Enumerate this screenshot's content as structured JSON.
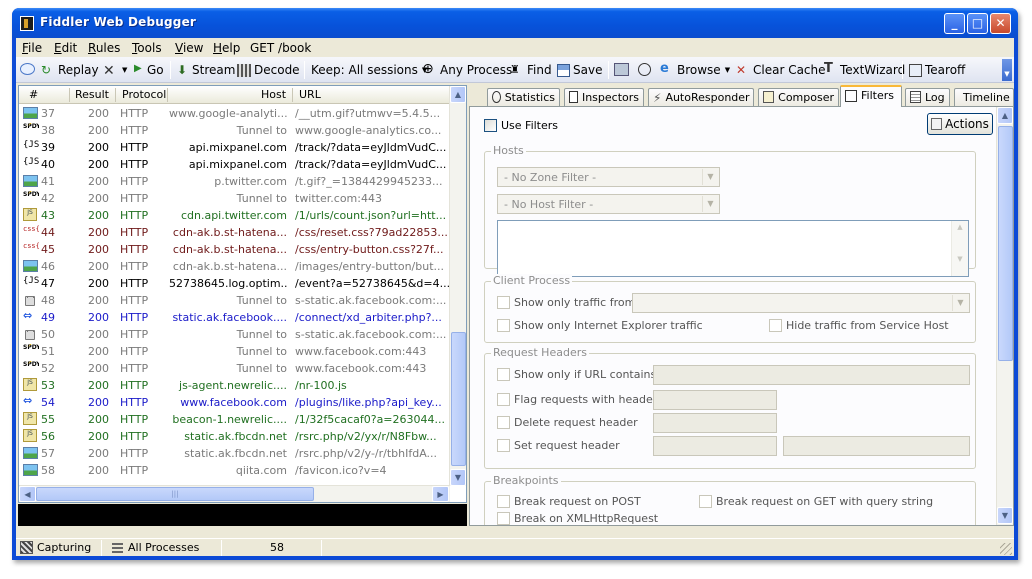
{
  "window": {
    "title": "Fiddler Web Debugger"
  },
  "menu": [
    {
      "label": "File",
      "u": "F",
      "rest": "ile"
    },
    {
      "label": "Edit",
      "u": "E",
      "rest": "dit"
    },
    {
      "label": "Rules",
      "u": "R",
      "rest": "ules"
    },
    {
      "label": "Tools",
      "u": "T",
      "rest": "ools"
    },
    {
      "label": "View",
      "u": "V",
      "rest": "iew"
    },
    {
      "label": "Help",
      "u": "H",
      "rest": "elp"
    },
    {
      "label": "GET /book",
      "u": "",
      "rest": "GET /book"
    }
  ],
  "toolbar": {
    "replay": "Replay",
    "go": "Go",
    "stream": "Stream",
    "decode": "Decode",
    "keep": "Keep: All sessions",
    "any_process": "Any Process",
    "find": "Find",
    "save": "Save",
    "browse": "Browse",
    "clear_cache": "Clear Cache",
    "textwizard": "TextWizard",
    "tearoff": "Tearoff"
  },
  "grid": {
    "headers": {
      "num": "#",
      "result": "Result",
      "protocol": "Protocol",
      "host": "Host",
      "url": "URL"
    },
    "rows": [
      {
        "icon": "img",
        "num": "37",
        "result": "200",
        "protocol": "HTTP",
        "host": "www.google-analyti...",
        "url": "/__utm.gif?utmwv=5.4.5...",
        "color": "gray"
      },
      {
        "icon": "spdy",
        "num": "38",
        "result": "200",
        "protocol": "HTTP",
        "host": "Tunnel to",
        "url": "www.google-analytics.co...",
        "color": "gray"
      },
      {
        "icon": "json",
        "num": "39",
        "result": "200",
        "protocol": "HTTP",
        "host": "api.mixpanel.com",
        "url": "/track/?data=eyJldmVudC...",
        "color": "black"
      },
      {
        "icon": "json",
        "num": "40",
        "result": "200",
        "protocol": "HTTP",
        "host": "api.mixpanel.com",
        "url": "/track/?data=eyJldmVudC...",
        "color": "black"
      },
      {
        "icon": "img",
        "num": "41",
        "result": "200",
        "protocol": "HTTP",
        "host": "p.twitter.com",
        "url": "/t.gif?_=1384429945233...",
        "color": "gray"
      },
      {
        "icon": "spdy",
        "num": "42",
        "result": "200",
        "protocol": "HTTP",
        "host": "Tunnel to",
        "url": "twitter.com:443",
        "color": "gray"
      },
      {
        "icon": "js",
        "num": "43",
        "result": "200",
        "protocol": "HTTP",
        "host": "cdn.api.twitter.com",
        "url": "/1/urls/count.json?url=htt...",
        "color": "green"
      },
      {
        "icon": "css",
        "num": "44",
        "result": "200",
        "protocol": "HTTP",
        "host": "cdn-ak.b.st-hatena...",
        "url": "/css/reset.css?79ad22853...",
        "color": "maroon"
      },
      {
        "icon": "css",
        "num": "45",
        "result": "200",
        "protocol": "HTTP",
        "host": "cdn-ak.b.st-hatena...",
        "url": "/css/entry-button.css?27f...",
        "color": "maroon"
      },
      {
        "icon": "img",
        "num": "46",
        "result": "200",
        "protocol": "HTTP",
        "host": "cdn-ak.b.st-hatena...",
        "url": "/images/entry-button/but...",
        "color": "gray"
      },
      {
        "icon": "json",
        "num": "47",
        "result": "200",
        "protocol": "HTTP",
        "host": "52738645.log.optim...",
        "url": "/event?a=52738645&d=4...",
        "color": "black"
      },
      {
        "icon": "lock",
        "num": "48",
        "result": "200",
        "protocol": "HTTP",
        "host": "Tunnel to",
        "url": "s-static.ak.facebook.com:...",
        "color": "gray"
      },
      {
        "icon": "arrows",
        "num": "49",
        "result": "200",
        "protocol": "HTTP",
        "host": "static.ak.facebook....",
        "url": "/connect/xd_arbiter.php?...",
        "color": "blue"
      },
      {
        "icon": "lock",
        "num": "50",
        "result": "200",
        "protocol": "HTTP",
        "host": "Tunnel to",
        "url": "s-static.ak.facebook.com:...",
        "color": "gray"
      },
      {
        "icon": "spdy",
        "num": "51",
        "result": "200",
        "protocol": "HTTP",
        "host": "Tunnel to",
        "url": "www.facebook.com:443",
        "color": "gray"
      },
      {
        "icon": "spdy",
        "num": "52",
        "result": "200",
        "protocol": "HTTP",
        "host": "Tunnel to",
        "url": "www.facebook.com:443",
        "color": "gray"
      },
      {
        "icon": "js",
        "num": "53",
        "result": "200",
        "protocol": "HTTP",
        "host": "js-agent.newrelic....",
        "url": "/nr-100.js",
        "color": "green"
      },
      {
        "icon": "arrows",
        "num": "54",
        "result": "200",
        "protocol": "HTTP",
        "host": "www.facebook.com",
        "url": "/plugins/like.php?api_key...",
        "color": "blue"
      },
      {
        "icon": "js",
        "num": "55",
        "result": "200",
        "protocol": "HTTP",
        "host": "beacon-1.newrelic....",
        "url": "/1/32f5cacaf0?a=263044...",
        "color": "green"
      },
      {
        "icon": "js",
        "num": "56",
        "result": "200",
        "protocol": "HTTP",
        "host": "static.ak.fbcdn.net",
        "url": "/rsrc.php/v2/yx/r/N8Fbw...",
        "color": "green"
      },
      {
        "icon": "img",
        "num": "57",
        "result": "200",
        "protocol": "HTTP",
        "host": "static.ak.fbcdn.net",
        "url": "/rsrc.php/v2/y-/r/tbhIfdA...",
        "color": "gray"
      },
      {
        "icon": "img",
        "num": "58",
        "result": "200",
        "protocol": "HTTP",
        "host": "qiita.com",
        "url": "/favicon.ico?v=4",
        "color": "gray"
      }
    ]
  },
  "tabs": [
    {
      "label": "Statistics",
      "icon": "stopwatch-icon"
    },
    {
      "label": "Inspectors",
      "icon": "inspect-icon"
    },
    {
      "label": "AutoResponder",
      "icon": "lightning-icon"
    },
    {
      "label": "Composer",
      "icon": "compose-icon"
    },
    {
      "label": "Filters",
      "icon": "checkbox-icon"
    },
    {
      "label": "Log",
      "icon": "log-icon"
    },
    {
      "label": "Timeline",
      "icon": "timeline-icon"
    }
  ],
  "filters": {
    "use_filters": "Use Filters",
    "actions": "Actions",
    "hosts": {
      "title": "Hosts",
      "zone_filter": "- No Zone Filter -",
      "host_filter": "- No Host Filter -"
    },
    "client_process": {
      "title": "Client Process",
      "show_only_from": "Show only traffic from",
      "show_only_ie": "Show only Internet Explorer traffic",
      "hide_service_host": "Hide traffic from Service Host"
    },
    "request_headers": {
      "title": "Request Headers",
      "url_contains": "Show only if URL contains",
      "flag_header": "Flag requests with header",
      "delete_header": "Delete request header",
      "set_header": "Set request header"
    },
    "breakpoints": {
      "title": "Breakpoints",
      "on_post": "Break request on POST",
      "on_get_query": "Break request on GET with query string",
      "on_xhr": "Break on XMLHttpRequest"
    }
  },
  "status": {
    "capturing": "Capturing",
    "processes": "All Processes",
    "count": "58"
  }
}
